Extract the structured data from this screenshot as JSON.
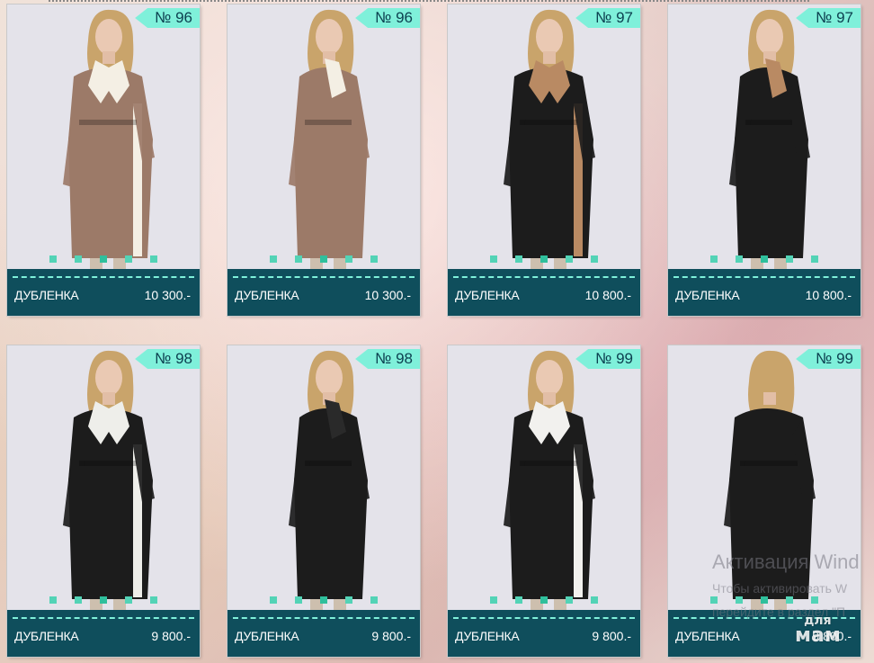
{
  "products": [
    {
      "number": "№ 96",
      "name": "ДУБЛЕНКА",
      "price": "10 300.-",
      "coat": "#9c7a68",
      "fur": "#f4efe4",
      "pose": "front"
    },
    {
      "number": "№ 96",
      "name": "ДУБЛЕНКА",
      "price": "10 300.-",
      "coat": "#9c7a68",
      "fur": "#f4efe4",
      "pose": "side"
    },
    {
      "number": "№ 97",
      "name": "ДУБЛЕНКА",
      "price": "10 800.-",
      "coat": "#1c1c1c",
      "fur": "#b98a63",
      "pose": "front"
    },
    {
      "number": "№ 97",
      "name": "ДУБЛЕНКА",
      "price": "10 800.-",
      "coat": "#1c1c1c",
      "fur": "#b98a63",
      "pose": "side"
    },
    {
      "number": "№ 98",
      "name": "ДУБЛЕНКА",
      "price": "9 800.-",
      "coat": "#1c1c1c",
      "fur": "#eeeeea",
      "pose": "front"
    },
    {
      "number": "№ 98",
      "name": "ДУБЛЕНКА",
      "price": "9 800.-",
      "coat": "#1c1c1c",
      "fur": "#2a2a2a",
      "pose": "side"
    },
    {
      "number": "№ 99",
      "name": "ДУБЛЕНКА",
      "price": "9 800.-",
      "coat": "#1c1c1c",
      "fur": "#f2f1ee",
      "pose": "front"
    },
    {
      "number": "№ 99",
      "name": "ДУБЛЕНКА",
      "price": "9 800.-",
      "coat": "#1c1c1c",
      "fur": "#2a2a2a",
      "pose": "back"
    }
  ],
  "watermark": {
    "title": "Активация Wind",
    "line1": "Чтобы активировать W",
    "line2": "перейдите в раздел \"П"
  },
  "logo": {
    "top": "для",
    "bottom": "мам"
  },
  "colors": {
    "accent": "#7ff0da",
    "bar": "#0f4e5c",
    "dot": "#53d3b6"
  }
}
